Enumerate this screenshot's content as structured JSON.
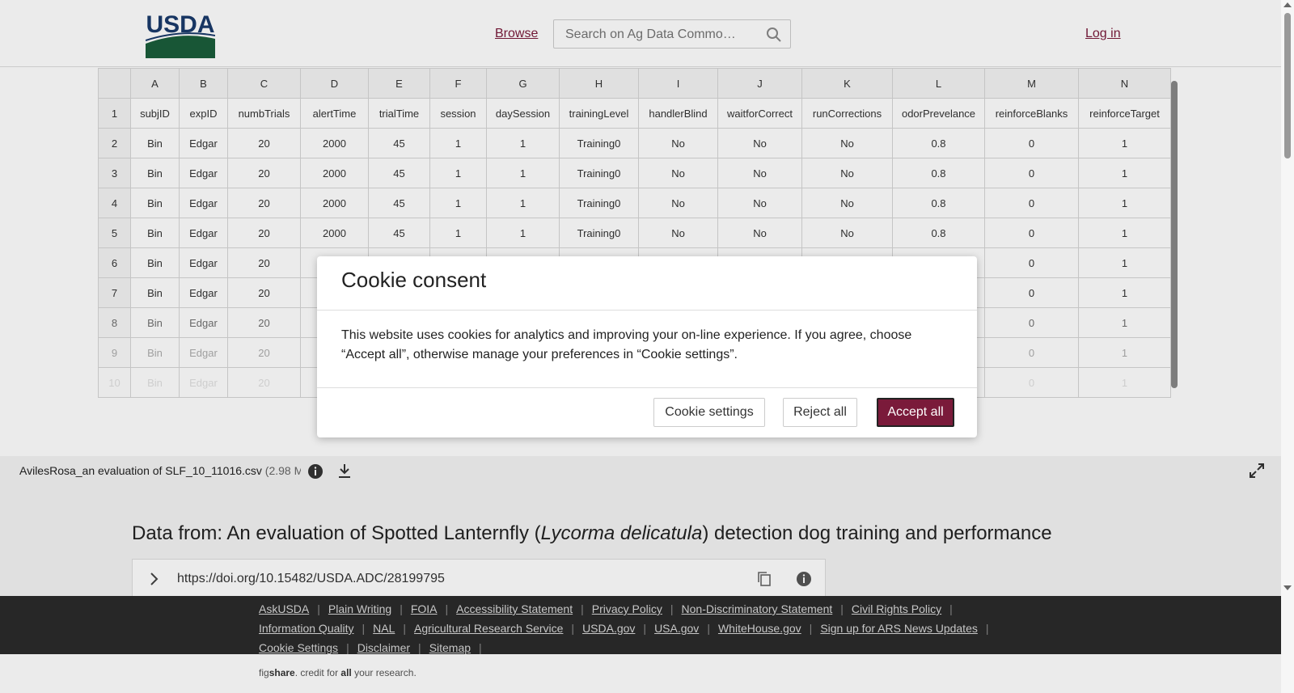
{
  "header": {
    "logo_text": "USDA",
    "browse": "Browse",
    "search_placeholder": "Search on Ag Data Commo…",
    "login": "Log in"
  },
  "sheet": {
    "column_letters": [
      "",
      "A",
      "B",
      "C",
      "D",
      "E",
      "F",
      "G",
      "H",
      "I",
      "J",
      "K",
      "L",
      "M",
      "N"
    ],
    "rows": [
      [
        "1",
        "subjID",
        "expID",
        "numbTrials",
        "alertTime",
        "trialTime",
        "session",
        "daySession",
        "trainingLevel",
        "handlerBlind",
        "waitforCorrect",
        "runCorrections",
        "odorPrevelance",
        "reinforceBlanks",
        "reinforceTarget"
      ],
      [
        "2",
        "Bin",
        "Edgar",
        "20",
        "2000",
        "45",
        "1",
        "1",
        "Training0",
        "No",
        "No",
        "No",
        "0.8",
        "0",
        "1"
      ],
      [
        "3",
        "Bin",
        "Edgar",
        "20",
        "2000",
        "45",
        "1",
        "1",
        "Training0",
        "No",
        "No",
        "No",
        "0.8",
        "0",
        "1"
      ],
      [
        "4",
        "Bin",
        "Edgar",
        "20",
        "2000",
        "45",
        "1",
        "1",
        "Training0",
        "No",
        "No",
        "No",
        "0.8",
        "0",
        "1"
      ],
      [
        "5",
        "Bin",
        "Edgar",
        "20",
        "2000",
        "45",
        "1",
        "1",
        "Training0",
        "No",
        "No",
        "No",
        "0.8",
        "0",
        "1"
      ],
      [
        "6",
        "Bin",
        "Edgar",
        "20",
        "",
        "",
        "",
        "",
        "",
        "",
        "",
        "",
        "",
        "0",
        "1"
      ],
      [
        "7",
        "Bin",
        "Edgar",
        "20",
        "",
        "",
        "",
        "",
        "",
        "",
        "",
        "",
        "",
        "0",
        "1"
      ],
      [
        "8",
        "Bin",
        "Edgar",
        "20",
        "",
        "",
        "",
        "",
        "",
        "",
        "",
        "",
        "",
        "0",
        "1"
      ],
      [
        "9",
        "Bin",
        "Edgar",
        "20",
        "",
        "",
        "",
        "",
        "",
        "",
        "",
        "",
        "",
        "0",
        "1"
      ],
      [
        "10",
        "Bin",
        "Edgar",
        "20",
        "",
        "",
        "",
        "",
        "",
        "",
        "",
        "",
        "",
        "0",
        "1"
      ]
    ]
  },
  "file": {
    "name": "AvilesRosa_an evaluation of SLF_10_11016.csv",
    "size": "(2.98 MB)"
  },
  "article": {
    "title_pre": "Data from: An evaluation of Spotted Lanternfly (",
    "title_italic": "Lycorma delicatula",
    "title_post": ") detection dog training and performance",
    "doi": "https://doi.org/10.15482/USDA.ADC/28199795"
  },
  "footer": {
    "links": [
      "AskUSDA",
      "Plain Writing",
      "FOIA",
      "Accessibility Statement",
      "Privacy Policy",
      "Non-Discriminatory Statement",
      "Civil Rights Policy",
      "Information Quality",
      "NAL",
      "Agricultural Research Service",
      "USDA.gov",
      "USA.gov",
      "WhiteHouse.gov",
      "Sign up for ARS News Updates",
      "Cookie Settings",
      "Disclaimer",
      "Sitemap"
    ],
    "credit_pre": "fig",
    "credit_bold1": "share",
    "credit_mid": ". credit for ",
    "credit_bold2": "all",
    "credit_post": " your research."
  },
  "cookie": {
    "title": "Cookie consent",
    "body": "This website uses cookies for analytics and improving your on-line experience. If you agree, choose “Accept all”, otherwise manage your preferences in “Cookie settings”.",
    "settings": "Cookie settings",
    "reject": "Reject all",
    "accept": "Accept all",
    "accent": "#7a1a3a"
  }
}
